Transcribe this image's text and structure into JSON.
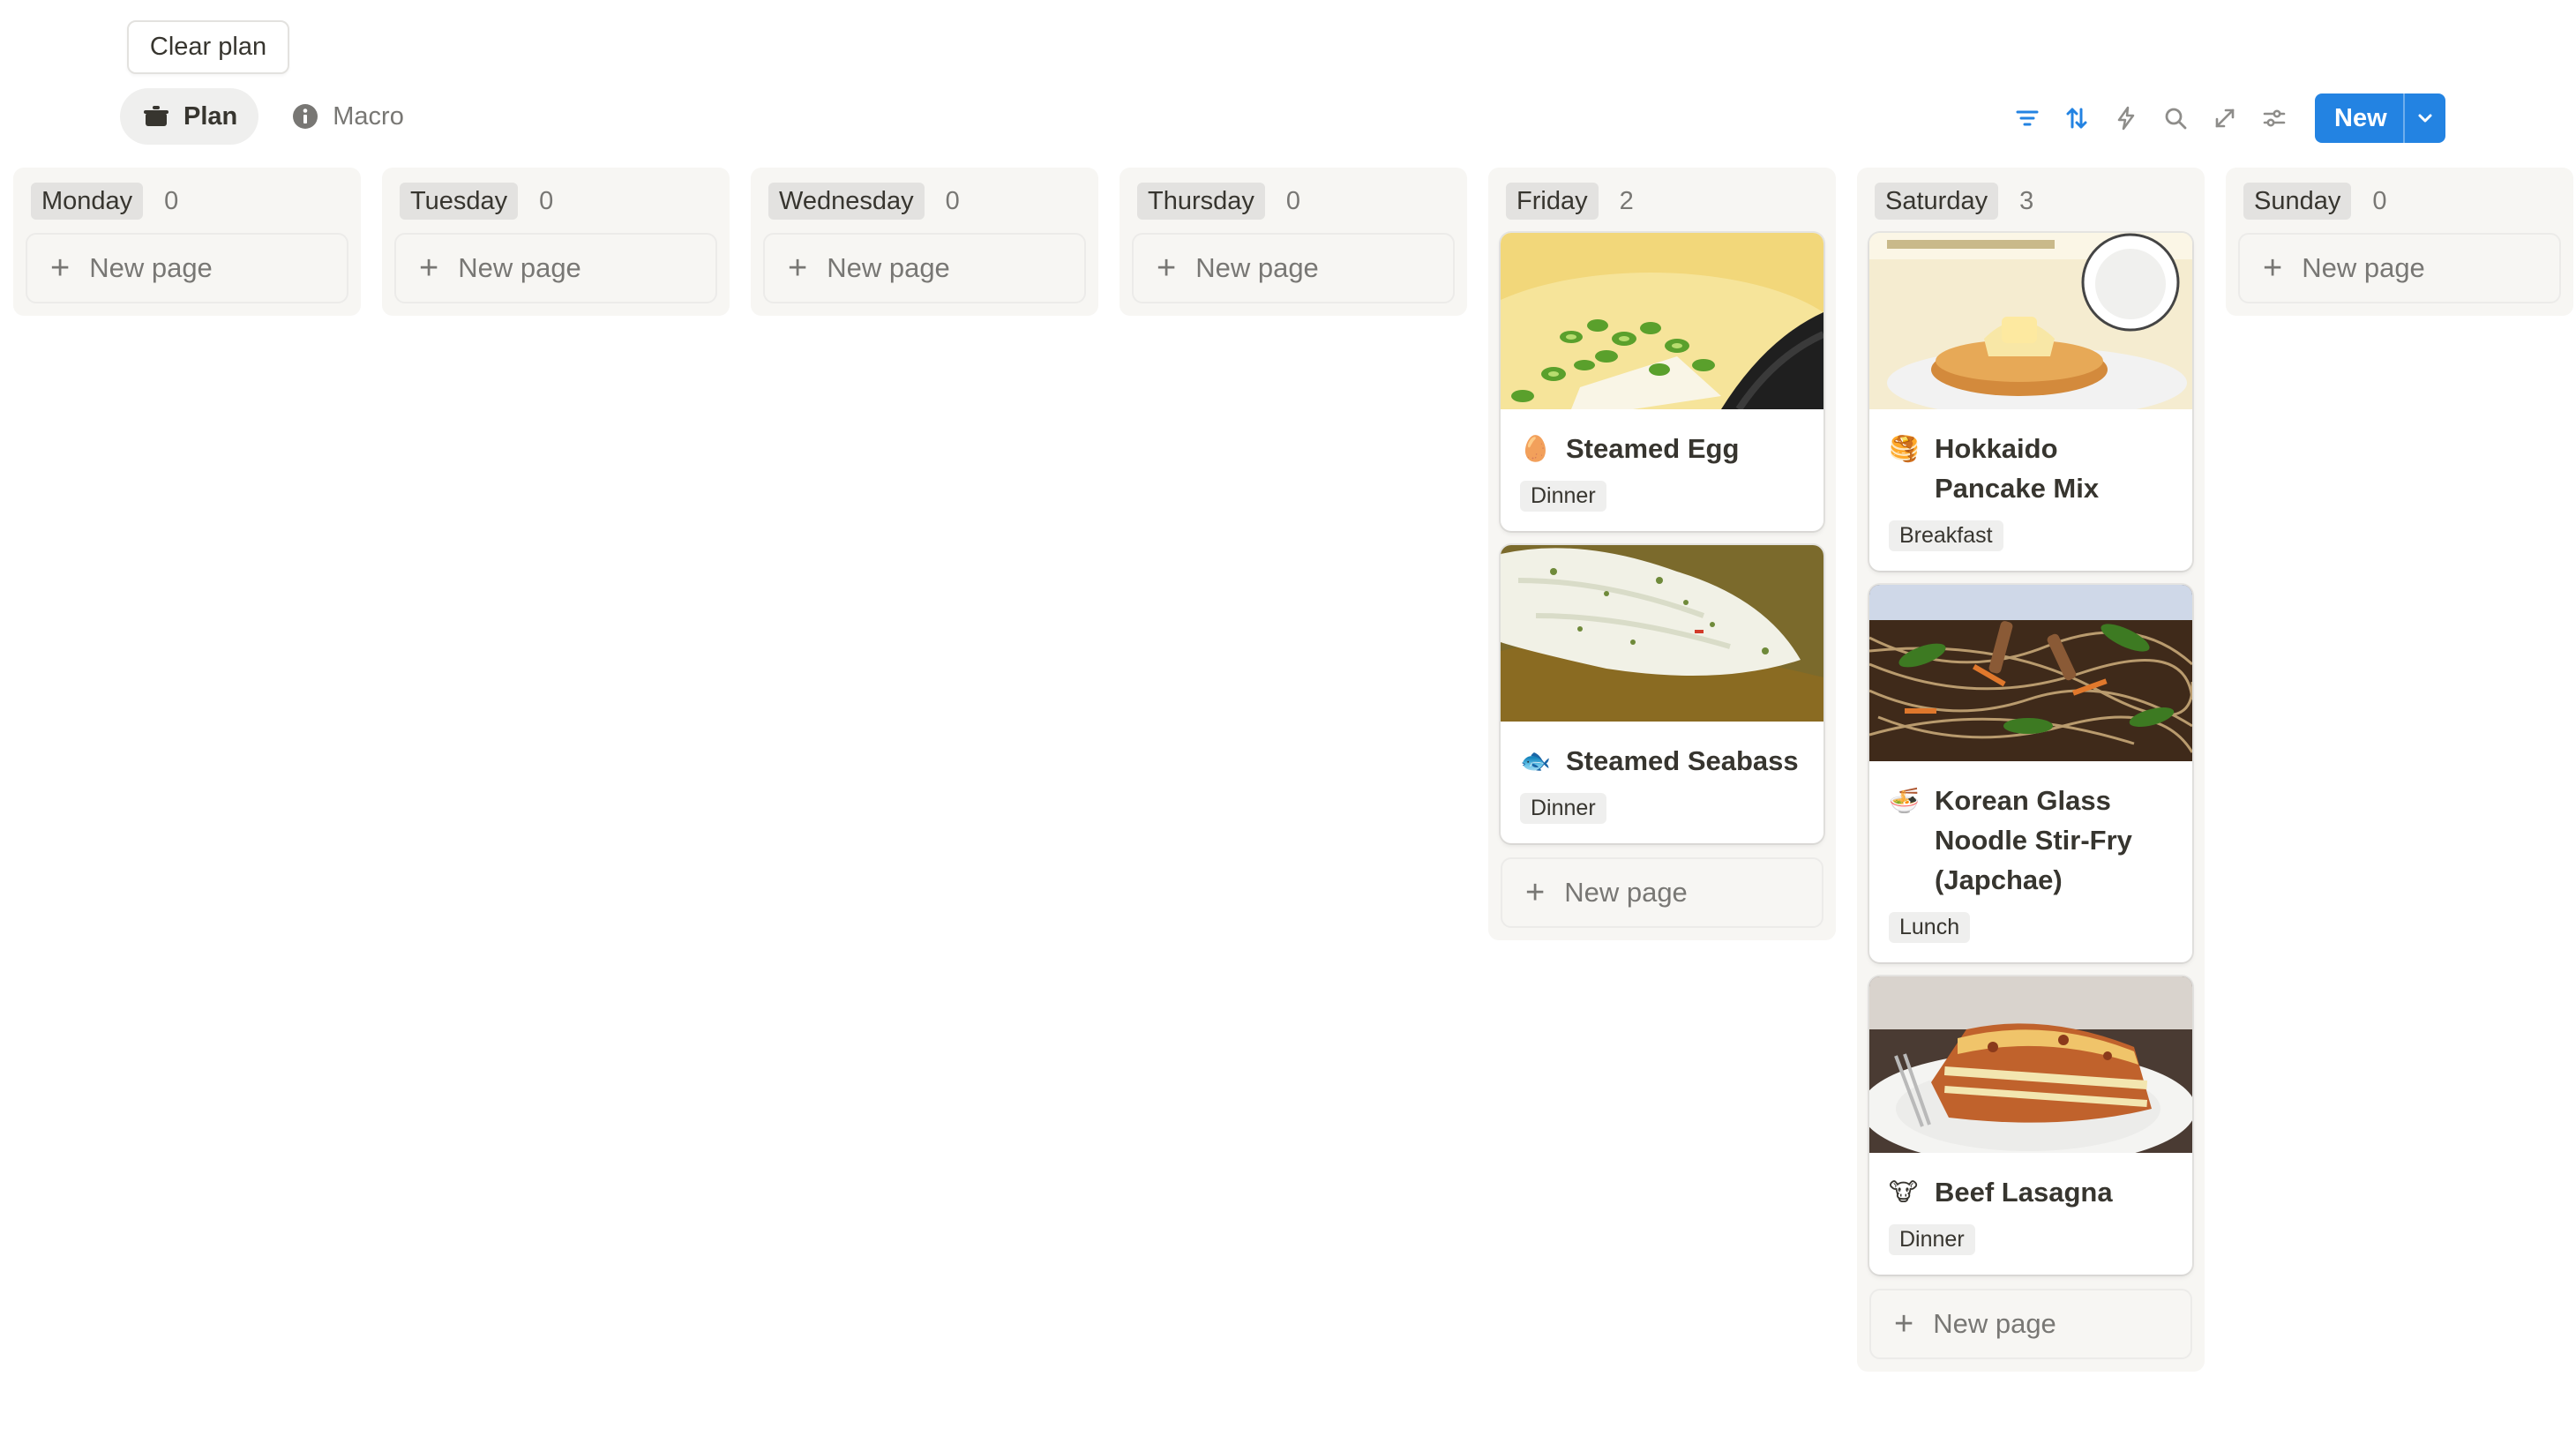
{
  "actions": {
    "clear_plan": "Clear plan"
  },
  "views": [
    {
      "label": "Plan",
      "icon": "pot-icon",
      "active": true
    },
    {
      "label": "Macro",
      "icon": "info-icon",
      "active": false
    }
  ],
  "toolbar": {
    "tools": [
      "filter-icon",
      "sort-icon",
      "automation-icon",
      "search-icon",
      "expand-icon",
      "settings-icon"
    ],
    "new_label": "New",
    "accent": "#2383e2"
  },
  "board": {
    "new_page_label": "New page",
    "columns": [
      {
        "day": "Monday",
        "count": "0"
      },
      {
        "day": "Tuesday",
        "count": "0"
      },
      {
        "day": "Wednesday",
        "count": "0"
      },
      {
        "day": "Thursday",
        "count": "0"
      },
      {
        "day": "Friday",
        "count": "2",
        "cards": [
          {
            "title": "Steamed Egg",
            "emoji": "🥚",
            "tag": "Dinner"
          },
          {
            "title": "Steamed Seabass",
            "emoji": "🐟",
            "tag": "Dinner"
          }
        ]
      },
      {
        "day": "Saturday",
        "count": "3",
        "cards": [
          {
            "title": "Hokkaido Pancake Mix",
            "emoji": "🥞",
            "tag": "Breakfast"
          },
          {
            "title": "Korean Glass Noodle Stir-Fry (Japchae)",
            "emoji": "🍜",
            "tag": "Lunch"
          },
          {
            "title": "Beef Lasagna",
            "emoji": "🐮",
            "tag": "Dinner"
          }
        ]
      },
      {
        "day": "Sunday",
        "count": "0"
      }
    ]
  }
}
